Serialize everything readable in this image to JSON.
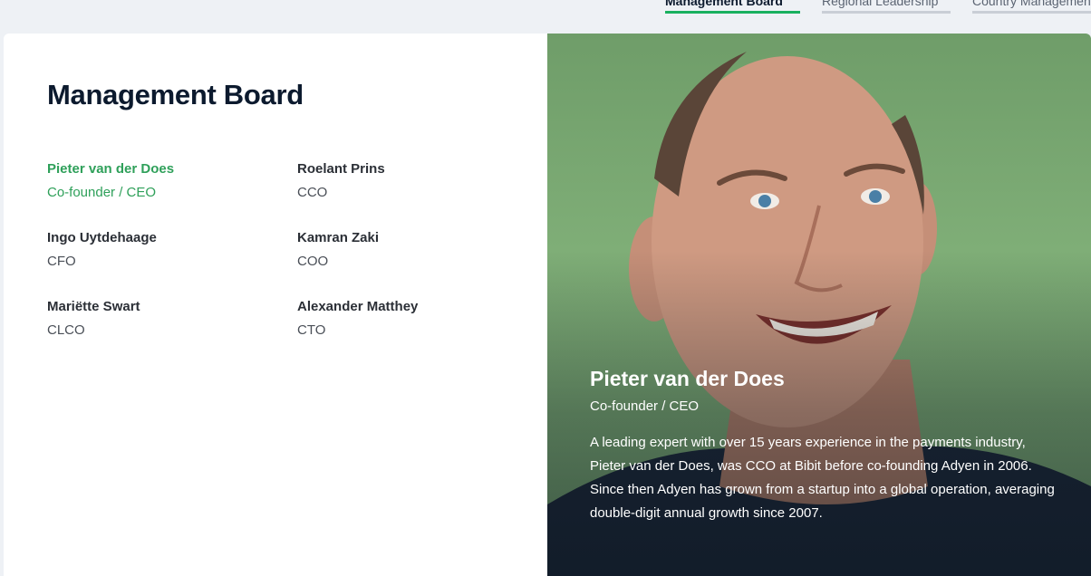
{
  "tabs": [
    {
      "label": "Management Board",
      "active": true
    },
    {
      "label": "Regional Leadership",
      "active": false
    },
    {
      "label": "Country Management",
      "active": false
    }
  ],
  "section": {
    "title": "Management Board"
  },
  "members": [
    {
      "name": "Pieter van der Does",
      "role": "Co-founder / CEO",
      "active": true
    },
    {
      "name": "Roelant Prins",
      "role": "CCO",
      "active": false
    },
    {
      "name": "Ingo Uytdehaage",
      "role": "CFO",
      "active": false
    },
    {
      "name": "Kamran Zaki",
      "role": "COO",
      "active": false
    },
    {
      "name": "Mariëtte Swart",
      "role": "CLCO",
      "active": false
    },
    {
      "name": "Alexander Matthey",
      "role": "CTO",
      "active": false
    }
  ],
  "profile": {
    "name": "Pieter van der Does",
    "role": "Co-founder / CEO",
    "bio": "A leading expert with over 15 years experience in the payments industry, Pieter van der Does, was CCO at Bibit before co-founding Adyen in 2006. Since then Adyen has grown from a startup into a global operation, averaging double-digit annual growth since 2007."
  },
  "colors": {
    "accent_green": "#19b05f",
    "active_member_green": "#2fa05a",
    "photo_background_green": "#7fae77",
    "title_navy": "#0c1a2e"
  }
}
